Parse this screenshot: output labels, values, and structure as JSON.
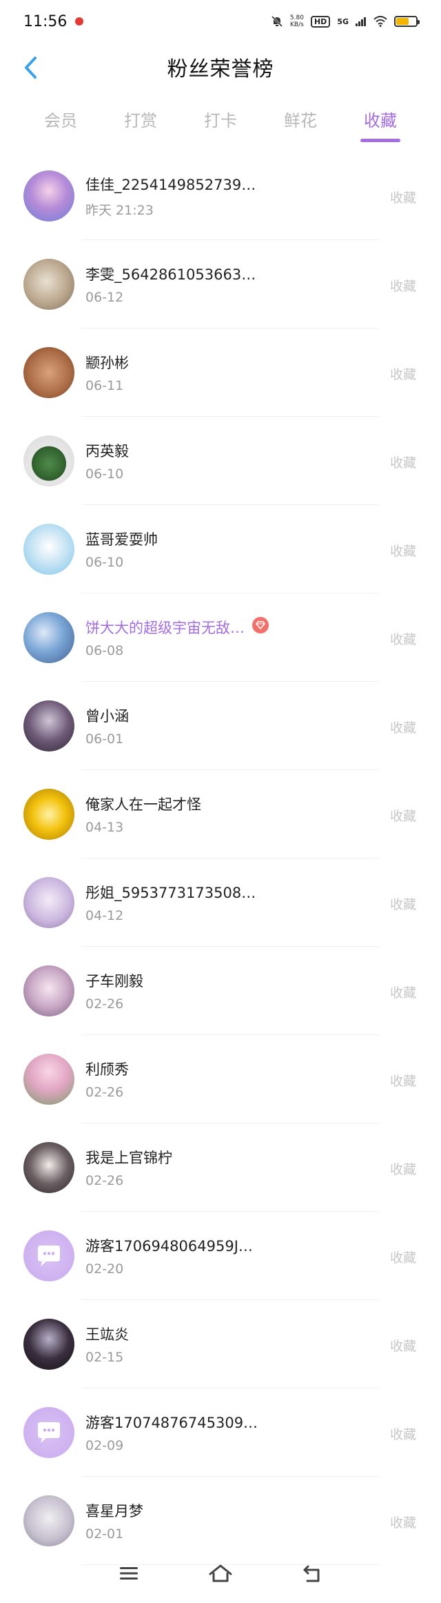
{
  "status": {
    "time": "11:56",
    "net_speed": "5.80",
    "net_unit": "KB/s",
    "hd": "HD",
    "signal": "5G",
    "battery_level": 0.6
  },
  "header": {
    "title": "粉丝荣誉榜"
  },
  "tabs": [
    {
      "label": "会员",
      "active": false
    },
    {
      "label": "打赏",
      "active": false
    },
    {
      "label": "打卡",
      "active": false
    },
    {
      "label": "鲜花",
      "active": false
    },
    {
      "label": "收藏",
      "active": true
    }
  ],
  "fans": [
    {
      "name": "佳佳_2254149852739…",
      "date": "昨天 21:23",
      "action": "收藏"
    },
    {
      "name": "李雯_5642861053663…",
      "date": "06-12",
      "action": "收藏"
    },
    {
      "name": "颛孙彬",
      "date": "06-11",
      "action": "收藏"
    },
    {
      "name": "丙英毅",
      "date": "06-10",
      "action": "收藏"
    },
    {
      "name": "蓝哥爱耍帅",
      "date": "06-10",
      "action": "收藏"
    },
    {
      "name": "饼大大的超级宇宙无敌…",
      "date": "06-08",
      "action": "收藏",
      "vip": true
    },
    {
      "name": "曾小涵",
      "date": "06-01",
      "action": "收藏"
    },
    {
      "name": "俺家人在一起才怪",
      "date": "04-13",
      "action": "收藏"
    },
    {
      "name": "彤姐_5953773173508…",
      "date": "04-12",
      "action": "收藏"
    },
    {
      "name": "子车刚毅",
      "date": "02-26",
      "action": "收藏"
    },
    {
      "name": "利颀秀",
      "date": "02-26",
      "action": "收藏"
    },
    {
      "name": "我是上官锦柠",
      "date": "02-26",
      "action": "收藏"
    },
    {
      "name": "游客1706948064959J…",
      "date": "02-20",
      "action": "收藏"
    },
    {
      "name": "王竑炎",
      "date": "02-15",
      "action": "收藏"
    },
    {
      "name": "游客17074876745309…",
      "date": "02-09",
      "action": "收藏"
    },
    {
      "name": "喜星月梦",
      "date": "02-01",
      "action": "收藏"
    }
  ],
  "colors": {
    "accent": "#a46ee0",
    "vip_badge": "#f2706a"
  }
}
